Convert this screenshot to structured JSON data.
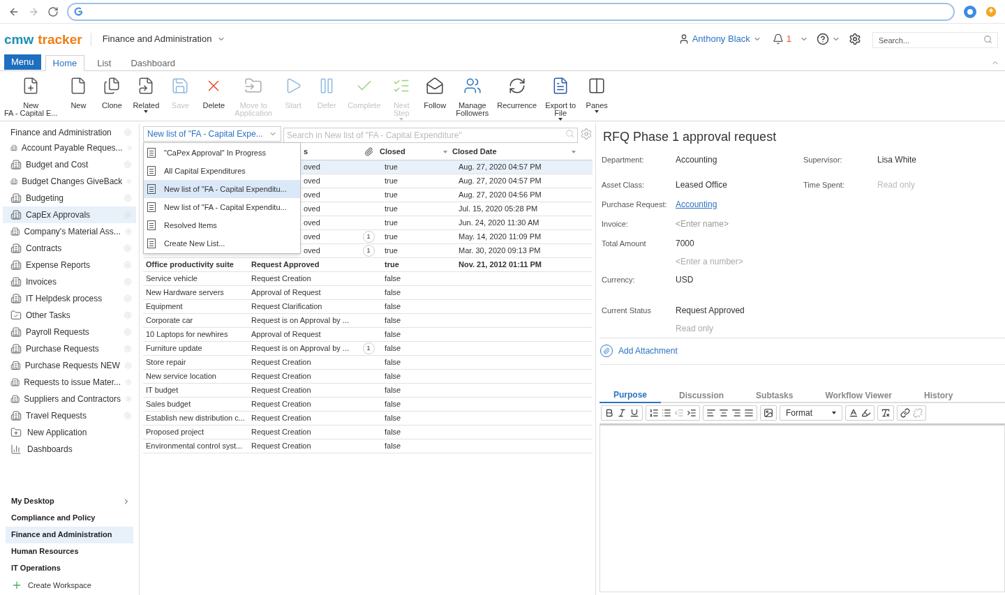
{
  "header": {
    "logo_first": "cmw",
    "logo_second": "tracker",
    "workspace": "Finance and Administration",
    "user": "Anthony Black",
    "notifications": "1",
    "search_placeholder": "Search..."
  },
  "tabs": [
    {
      "label": "Menu",
      "kind": "menu",
      "selected": false
    },
    {
      "label": "Home",
      "kind": "tab",
      "selected": true
    },
    {
      "label": "List",
      "kind": "tab",
      "selected": false
    },
    {
      "label": "Dashboard",
      "kind": "tab",
      "selected": false
    }
  ],
  "ribbon": [
    {
      "kind": "new-app",
      "lines": [
        "New",
        "FA - Capital E..."
      ],
      "disabled": false,
      "dropdown": false
    },
    {
      "kind": "new",
      "lines": [
        "New"
      ],
      "disabled": false,
      "dropdown": false
    },
    {
      "kind": "clone",
      "lines": [
        "Clone"
      ],
      "disabled": false,
      "dropdown": false
    },
    {
      "kind": "related",
      "lines": [
        "Related"
      ],
      "disabled": false,
      "dropdown": true
    },
    {
      "kind": "save",
      "lines": [
        "Save"
      ],
      "disabled": true,
      "dropdown": false
    },
    {
      "kind": "delete",
      "lines": [
        "Delete"
      ],
      "disabled": false,
      "dropdown": false
    },
    {
      "kind": "move",
      "lines": [
        "Move to",
        "Application"
      ],
      "disabled": true,
      "dropdown": false
    },
    {
      "kind": "start",
      "lines": [
        "Start"
      ],
      "disabled": true,
      "dropdown": false
    },
    {
      "kind": "defer",
      "lines": [
        "Defer"
      ],
      "disabled": true,
      "dropdown": false
    },
    {
      "kind": "complete",
      "lines": [
        "Complete"
      ],
      "disabled": true,
      "dropdown": false
    },
    {
      "kind": "next",
      "lines": [
        "Next",
        "Step"
      ],
      "disabled": true,
      "dropdown": true
    },
    {
      "kind": "follow",
      "lines": [
        "Follow"
      ],
      "disabled": false,
      "dropdown": false
    },
    {
      "kind": "followers",
      "lines": [
        "Manage",
        "Followers"
      ],
      "disabled": false,
      "dropdown": false
    },
    {
      "kind": "recurrence",
      "lines": [
        "Recurrence"
      ],
      "disabled": false,
      "dropdown": false
    },
    {
      "kind": "export",
      "lines": [
        "Export to",
        "File"
      ],
      "disabled": false,
      "dropdown": true
    },
    {
      "kind": "panes",
      "lines": [
        "Panes"
      ],
      "disabled": false,
      "dropdown": true
    }
  ],
  "sidebar": {
    "title": "Finance and Administration",
    "apps": [
      {
        "label": "Account Payable Reques...",
        "kind": "app",
        "selected": false
      },
      {
        "label": "Budget and Cost",
        "kind": "app",
        "selected": false
      },
      {
        "label": "Budget Changes GiveBack",
        "kind": "app",
        "selected": false
      },
      {
        "label": "Budgeting",
        "kind": "app",
        "selected": false
      },
      {
        "label": "CapEx Approvals",
        "kind": "app",
        "selected": true
      },
      {
        "label": "Company's Material Ass...",
        "kind": "asset",
        "selected": false
      },
      {
        "label": "Contracts",
        "kind": "app",
        "selected": false
      },
      {
        "label": "Expense Reports",
        "kind": "app",
        "selected": false
      },
      {
        "label": "Invoices",
        "kind": "app",
        "selected": false
      },
      {
        "label": "IT Helpdesk process",
        "kind": "app",
        "selected": false
      },
      {
        "label": "Other Tasks",
        "kind": "task",
        "selected": false
      },
      {
        "label": "Payroll Requests",
        "kind": "app",
        "selected": false
      },
      {
        "label": "Purchase Requests",
        "kind": "app",
        "selected": false
      },
      {
        "label": "Purchase Requests NEW",
        "kind": "app",
        "selected": false
      },
      {
        "label": "Requests to issue Mater...",
        "kind": "app",
        "selected": false
      },
      {
        "label": "Suppliers and Contractors",
        "kind": "asset",
        "selected": false
      },
      {
        "label": "Travel Requests",
        "kind": "app",
        "selected": false
      },
      {
        "label": "New Application",
        "kind": "new",
        "selected": false
      },
      {
        "label": "Dashboards",
        "kind": "dashboards",
        "selected": false
      }
    ],
    "workspaces": [
      {
        "label": "My Desktop",
        "expandable": true,
        "selected": false
      },
      {
        "label": "Compliance and Policy",
        "expandable": false,
        "selected": false
      },
      {
        "label": "Finance and Administration",
        "expandable": false,
        "selected": true
      },
      {
        "label": "Human Resources",
        "expandable": false,
        "selected": false
      },
      {
        "label": "IT Operations",
        "expandable": false,
        "selected": false
      }
    ],
    "create_workspace": "Create Workspace"
  },
  "list": {
    "selector": "New list of \"FA - Capital Expe...",
    "search_placeholder": "Search in New list of \"FA - Capital Expenditure\"",
    "columns": [
      {
        "kind": "text",
        "label": "s"
      },
      {
        "kind": "attachment"
      },
      {
        "kind": "text",
        "label": "Closed",
        "sortable": true
      },
      {
        "kind": "text",
        "label": "Closed Date",
        "sortable": true
      }
    ],
    "rows": [
      {
        "status": "oved",
        "closed": "true",
        "date": "Aug. 27, 2020 04:57 PM",
        "selected": true,
        "bold": false
      },
      {
        "status": "oved",
        "closed": "true",
        "date": "Aug. 27, 2020 04:57 PM",
        "selected": false,
        "bold": false
      },
      {
        "status": "oved",
        "closed": "true",
        "date": "Aug. 27, 2020 04:56 PM",
        "selected": false,
        "bold": false
      },
      {
        "status": "oved",
        "closed": "true",
        "date": "Jul. 15, 2020 05:28 PM",
        "selected": false,
        "bold": false
      },
      {
        "status": "oved",
        "closed": "true",
        "date": "Jun. 24, 2020 11:30 AM",
        "selected": false,
        "bold": false
      },
      {
        "status": "oved",
        "attachments": "1",
        "closed": "true",
        "date": "May. 14, 2020 11:09 PM",
        "selected": false,
        "bold": false
      },
      {
        "status": "oved",
        "attachments": "1",
        "closed": "true",
        "date": "Mar. 30, 2020 09:13 PM",
        "selected": false,
        "bold": false
      },
      {
        "name": "Office productivity suite",
        "status": "Request Approved",
        "closed": "true",
        "date": "Nov. 21, 2012 01:11 PM",
        "selected": false,
        "bold": true
      },
      {
        "name": "Service vehicle",
        "status": "Request Creation",
        "closed": "false",
        "selected": false,
        "bold": false
      },
      {
        "name": "New Hardware servers",
        "status": "Approval of Request",
        "closed": "false",
        "selected": false,
        "bold": false
      },
      {
        "name": "Equipment",
        "status": "Request Clarification",
        "closed": "false",
        "selected": false,
        "bold": false
      },
      {
        "name": "Corporate car",
        "status": "Request is on Approval by ...",
        "closed": "false",
        "selected": false,
        "bold": false
      },
      {
        "name": "10 Laptops for newhires",
        "status": "Approval of Request",
        "closed": "false",
        "selected": false,
        "bold": false
      },
      {
        "name": "Furniture update",
        "status": "Request is on Approval by ...",
        "attachments": "1",
        "closed": "false",
        "selected": false,
        "bold": false
      },
      {
        "name": "Store repair",
        "status": "Request Creation",
        "closed": "false",
        "selected": false,
        "bold": false
      },
      {
        "name": "New service location",
        "status": "Request Creation",
        "closed": "false",
        "selected": false,
        "bold": false
      },
      {
        "name": "IT budget",
        "status": "Request Creation",
        "closed": "false",
        "selected": false,
        "bold": false
      },
      {
        "name": "Sales budget",
        "status": "Request Creation",
        "closed": "false",
        "selected": false,
        "bold": false
      },
      {
        "name": "Establish new distribution c...",
        "status": "Request Creation",
        "closed": "false",
        "selected": false,
        "bold": false
      },
      {
        "name": "Proposed project",
        "status": "Request Creation",
        "closed": "false",
        "selected": false,
        "bold": false
      },
      {
        "name": "Environmental control syst...",
        "status": "Request Creation",
        "closed": "false",
        "selected": false,
        "bold": false
      }
    ],
    "dropdown": [
      {
        "label": "\"CaPex Approval\" In Progress",
        "selected": false
      },
      {
        "label": "All Capital Expenditures",
        "selected": false
      },
      {
        "label": "New list of \"FA - Capital Expenditu...",
        "selected": true
      },
      {
        "label": "New list of \"FA - Capital Expenditu...",
        "selected": false
      },
      {
        "label": "Resolved Items",
        "selected": false
      },
      {
        "label": "Create New List...",
        "selected": false
      }
    ]
  },
  "detail": {
    "title": "RFQ Phase 1 approval request",
    "rows": [
      {
        "fields": [
          {
            "label": "Department:",
            "value": "Accounting",
            "kind": "text"
          },
          {
            "label": "Supervisor:",
            "value": "Lisa White",
            "kind": "text"
          }
        ]
      },
      {
        "fields": [
          {
            "label": "Asset Class:",
            "value": "Leased Office",
            "kind": "text"
          },
          {
            "label": "Time Spent:",
            "value": "Read only",
            "kind": "readonly"
          }
        ]
      },
      {
        "fields": [
          {
            "label": "Purchase Request:",
            "value": "Accounting",
            "kind": "link"
          }
        ]
      },
      {
        "fields": [
          {
            "label": "Invoice:",
            "placeholder": "<Enter name>",
            "kind": "placeholder"
          }
        ]
      },
      {
        "fields": [
          {
            "label": "Total Amount",
            "value": "7000",
            "kind": "text",
            "hint": "<Enter a number>"
          }
        ]
      },
      {
        "fields": [
          {
            "label": "Currency:",
            "value": "USD",
            "kind": "text"
          }
        ]
      },
      {
        "fields": [
          {
            "label": "Current Status",
            "value": "Request Approved",
            "kind": "text",
            "hint": "Read only"
          }
        ]
      }
    ],
    "add_attachment": "Add Attachment",
    "tabs": [
      {
        "label": "Purpose",
        "selected": true
      },
      {
        "label": "Discussion",
        "selected": false
      },
      {
        "label": "Subtasks",
        "selected": false
      },
      {
        "label": "Workflow Viewer",
        "selected": false
      },
      {
        "label": "History",
        "selected": false
      }
    ],
    "format_label": "Format"
  }
}
